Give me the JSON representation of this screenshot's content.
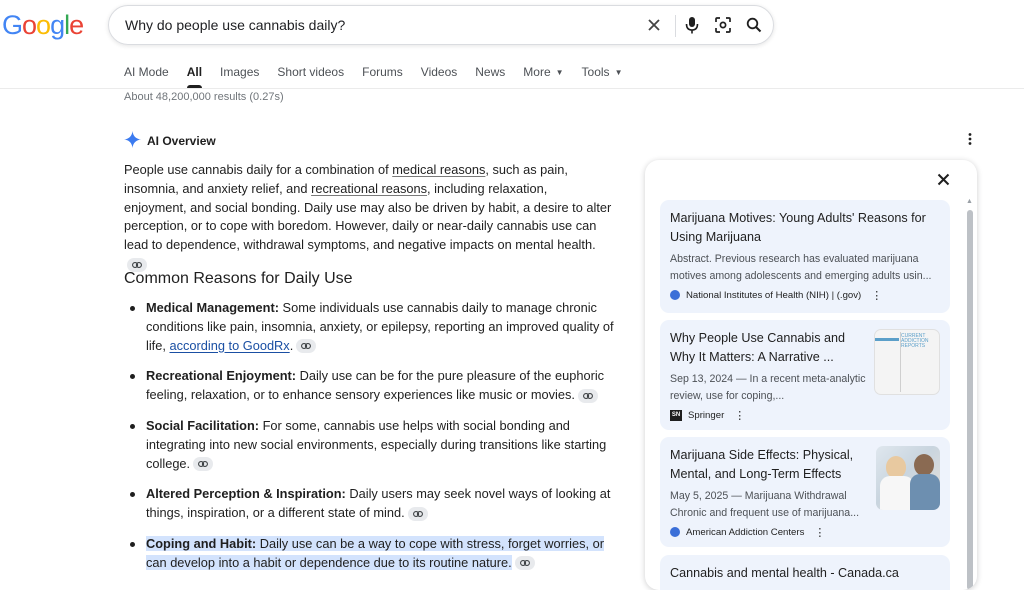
{
  "search": {
    "query": "Why do people use cannabis daily?"
  },
  "logo": {
    "letters": [
      "G",
      "o",
      "o",
      "g",
      "l",
      "e"
    ],
    "colors": [
      "#4285f4",
      "#ea4335",
      "#fbbc05",
      "#4285f4",
      "#34a853",
      "#ea4335"
    ]
  },
  "tabs": [
    {
      "label": "AI Mode"
    },
    {
      "label": "All",
      "active": true
    },
    {
      "label": "Images"
    },
    {
      "label": "Short videos"
    },
    {
      "label": "Forums"
    },
    {
      "label": "Videos"
    },
    {
      "label": "News"
    },
    {
      "label": "More",
      "dropdown": true
    },
    {
      "label": "Tools",
      "dropdown": true
    }
  ],
  "results_count": "About 48,200,000 results (0.27s)",
  "ai_overview": {
    "label": "AI Overview",
    "intro": {
      "p1": "People use cannabis daily for a combination of ",
      "link1": "medical reasons",
      "p2": ", such as pain, insomnia, and anxiety relief, and ",
      "link2": "recreational reasons",
      "p3": ", including relaxation, enjoyment, and social bonding. Daily use may also be driven by habit, a desire to alter perception, or to cope with boredom. However, daily or near-daily cannabis use can lead to dependence, withdrawal symptoms, and negative impacts on mental health."
    },
    "heading": "Common Reasons for Daily Use",
    "items": [
      {
        "title": "Medical Management:",
        "text": " Some individuals use cannabis daily to manage chronic conditions like pain, insomnia, anxiety, or epilepsy, reporting an improved quality of life, ",
        "link": "according to GoodRx",
        "after": "."
      },
      {
        "title": "Recreational Enjoyment:",
        "text": " Daily use can be for the pure pleasure of the euphoric feeling, relaxation, or to enhance sensory experiences like music or movies."
      },
      {
        "title": "Social Facilitation:",
        "text": " For some, cannabis use helps with social bonding and integrating into new social environments, especially during transitions like starting college."
      },
      {
        "title": "Altered Perception & Inspiration:",
        "text": " Daily users may seek novel ways of looking at things, inspiration, or a different state of mind."
      },
      {
        "title": "Coping and Habit:",
        "text": " Daily use can be a way to cope with stress, forget worries, or can develop into a habit or dependence due to its routine nature."
      }
    ]
  },
  "sources": [
    {
      "title": "Marijuana Motives: Young Adults' Reasons for Using Marijuana",
      "snippet": "Abstract. Previous research has evaluated marijuana motives among adolescents and emerging adults usin...",
      "source": "National Institutes of Health (NIH) | (.gov)"
    },
    {
      "title": "Why People Use Cannabis and Why It Matters: A Narrative ...",
      "snippet": "Sep 13, 2024 — In a recent meta-analytic review, use for coping,...",
      "source": "Springer",
      "thumb_text": "CURRENT ADDICTION REPORTS"
    },
    {
      "title": "Marijuana Side Effects: Physical, Mental, and Long-Term Effects",
      "snippet": "May 5, 2025 — Marijuana Withdrawal Chronic and frequent use of marijuana...",
      "source": "American Addiction Centers"
    },
    {
      "title": "Cannabis and mental health - Canada.ca"
    }
  ]
}
